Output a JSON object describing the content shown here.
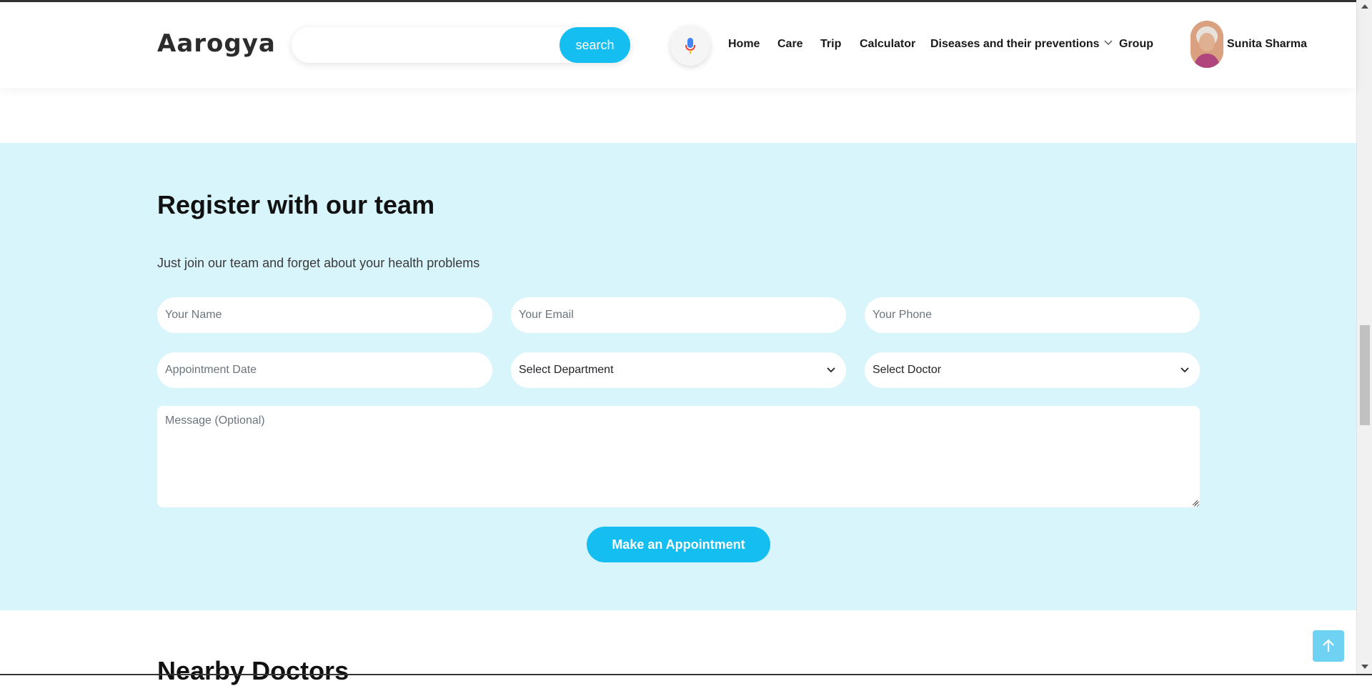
{
  "header": {
    "logo": "Aarogya",
    "search": {
      "placeholder": "",
      "button_label": "search"
    },
    "mic_icon": "microphone-icon",
    "nav": [
      {
        "label": "Home"
      },
      {
        "label": "Care"
      },
      {
        "label": "Trip"
      },
      {
        "label": "Calculator"
      },
      {
        "label": "Diseases and their preventions",
        "dropdown": true
      },
      {
        "label": "Group"
      }
    ],
    "user": {
      "name": "Sunita Sharma",
      "avatar_icon": "user-avatar"
    }
  },
  "register": {
    "title": "Register with our team",
    "subtitle": "Just join our team and forget about your health problems",
    "name_placeholder": "Your Name",
    "email_placeholder": "Your Email",
    "phone_placeholder": "Your Phone",
    "date_placeholder": "Appointment Date",
    "department_selected": "Select Department",
    "doctor_selected": "Select Doctor",
    "message_placeholder": "Message (Optional)",
    "submit_label": "Make an Appointment"
  },
  "nearby": {
    "title": "Nearby Doctors"
  },
  "colors": {
    "accent": "#14bef0",
    "section_bg": "#d9f5fc",
    "back_to_top": "#6fd2f3"
  }
}
